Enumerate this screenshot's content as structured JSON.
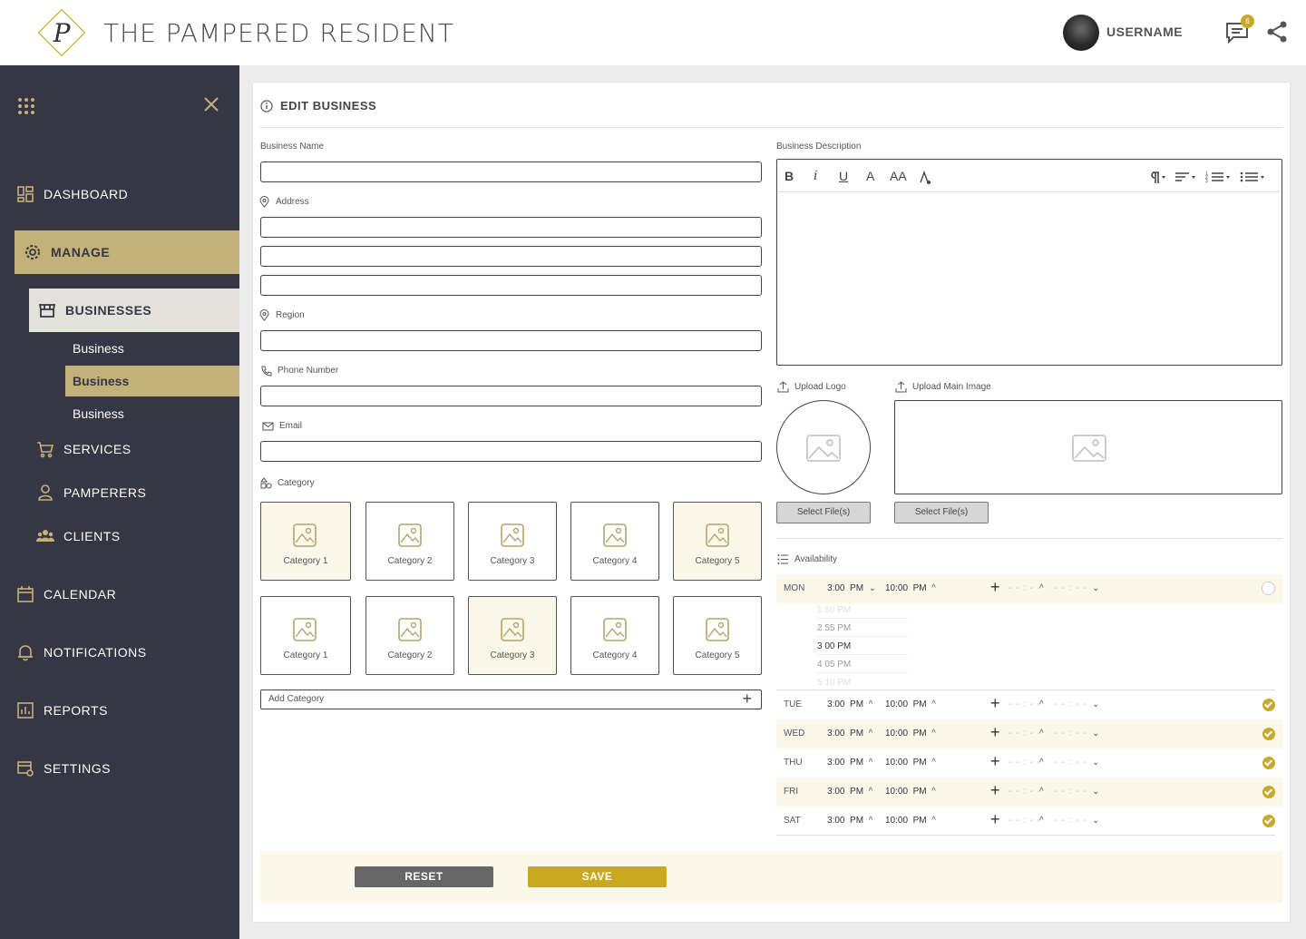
{
  "app": {
    "brand": "THE PAMPERED RESIDENT",
    "logo_letter": "P"
  },
  "header": {
    "username": "USERNAME",
    "message_count": "6"
  },
  "colors": {
    "gold": "#c9a92b",
    "sidebar": "#363644",
    "active": "#c2b27a",
    "tint": "#fbf8ea"
  },
  "sidebar": {
    "dashboard": "DASHBOARD",
    "manage": "MANAGE",
    "businesses": "BUSINESSES",
    "business_subs": [
      "Business",
      "Business",
      "Business"
    ],
    "services": "SERVICES",
    "pamperers": "PAMPERERS",
    "clients": "CLIENTS",
    "calendar": "CALENDAR",
    "notifications": "NOTIFICATIONS",
    "reports": "REPORTS",
    "settings": "SETTINGS"
  },
  "form": {
    "title": "EDIT BUSINESS",
    "business_name": "Business Name",
    "address": "Address",
    "region": "Region",
    "phone": "Phone Number",
    "email": "Email",
    "category": "Category",
    "add_category": "Add Category",
    "description": "Business Description",
    "upload_logo": "Upload Logo",
    "upload_main": "Upload Main Image",
    "select_files": "Select File(s)",
    "availability": "Availability",
    "reset": "RESET",
    "save": "SAVE"
  },
  "categories": [
    [
      "Category 1",
      "Category 2",
      "Category 3",
      "Category 4",
      "Category 5"
    ],
    [
      "Category 1",
      "Category 2",
      "Category 3",
      "Category 4",
      "Category 5"
    ]
  ],
  "toolbar": {
    "bold": "B",
    "italic": "i",
    "underline": "U",
    "font": "A",
    "size": "AA"
  },
  "availability": {
    "rows": [
      {
        "day": "MON",
        "start": "3:00",
        "start_ap": "PM",
        "end": "10:00",
        "end_ap": "PM",
        "checked": false
      },
      {
        "day": "TUE",
        "start": "3:00",
        "start_ap": "PM",
        "end": "10:00",
        "end_ap": "PM",
        "checked": true
      },
      {
        "day": "WED",
        "start": "3:00",
        "start_ap": "PM",
        "end": "10:00",
        "end_ap": "PM",
        "checked": true
      },
      {
        "day": "THU",
        "start": "3:00",
        "start_ap": "PM",
        "end": "10:00",
        "end_ap": "PM",
        "checked": true
      },
      {
        "day": "FRI",
        "start": "3:00",
        "start_ap": "PM",
        "end": "10:00",
        "end_ap": "PM",
        "checked": true
      },
      {
        "day": "SAT",
        "start": "3:00",
        "start_ap": "PM",
        "end": "10:00",
        "end_ap": "PM",
        "checked": true
      }
    ],
    "placeholder": "- - : - -",
    "wheel": [
      "1 50  PM",
      "2 55  PM",
      "3 00  PM",
      "4 05  PM",
      "5 10  PM"
    ]
  }
}
